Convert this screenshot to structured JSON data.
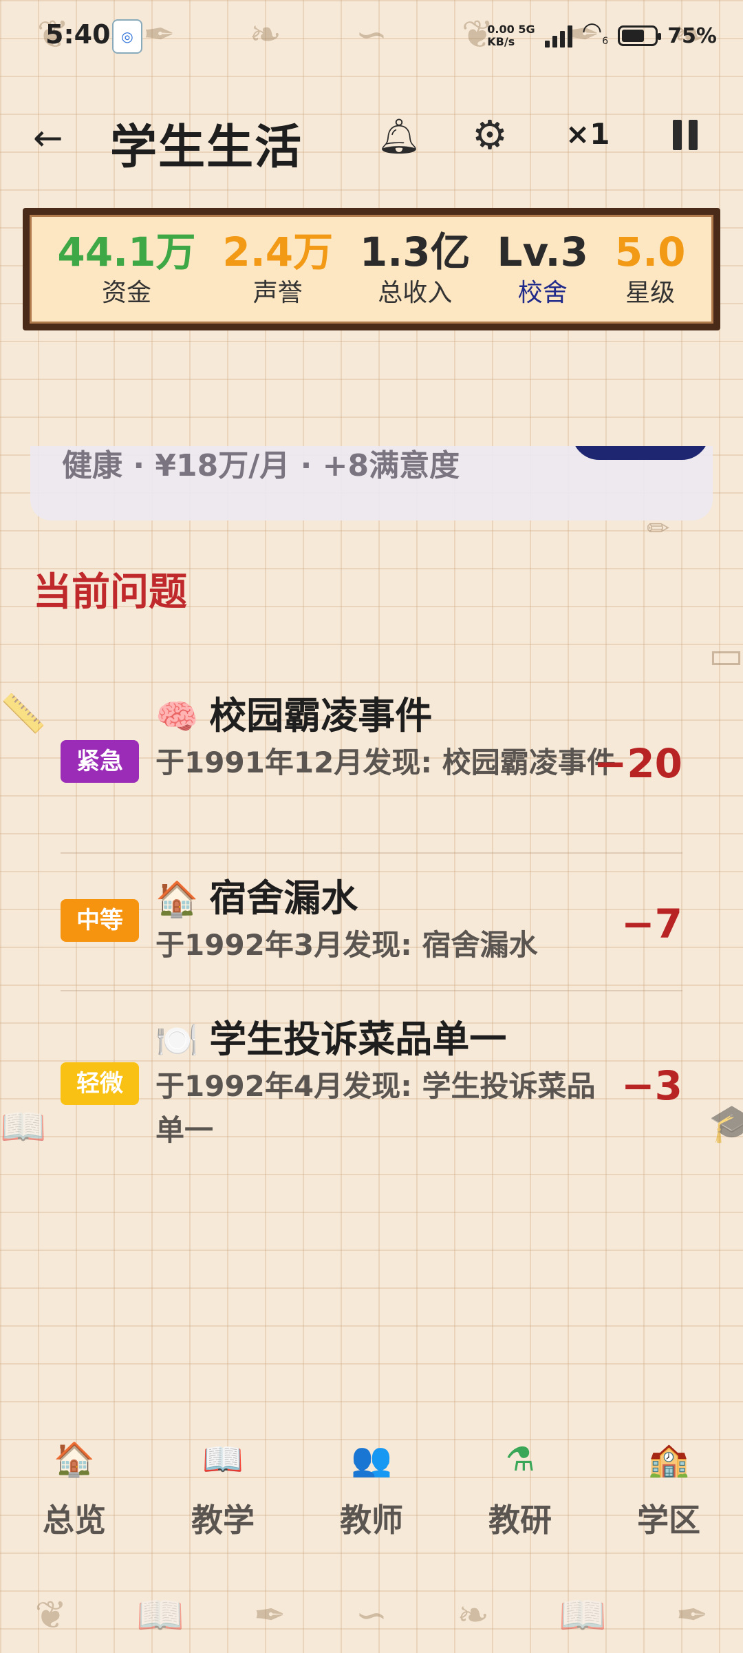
{
  "status_bar": {
    "time": "5:40",
    "network_speed_top": "0.00",
    "network_type": "5G",
    "network_speed_unit": "KB/s",
    "wifi_badge": "6",
    "battery": "75%"
  },
  "app_bar": {
    "title": "学生生活",
    "speed": "×1"
  },
  "stats": [
    {
      "value": "44.1万",
      "label": "资金",
      "value_color": "#3fa846",
      "label_color": "#333333"
    },
    {
      "value": "2.4万",
      "label": "声誉",
      "value_color": "#f29a16",
      "label_color": "#333333"
    },
    {
      "value": "1.3亿",
      "label": "总收入",
      "value_color": "#2b2b2b",
      "label_color": "#333333"
    },
    {
      "value": "Lv.3",
      "label": "校舍",
      "value_color": "#2b2b2b",
      "label_color": "#1f2a8a"
    },
    {
      "value": "5.0",
      "label": "星级",
      "value_color": "#f29a16",
      "label_color": "#333333"
    }
  ],
  "partial_card": {
    "text": "健康 · ¥18万/月 · +8满意度"
  },
  "section_title": "当前问题",
  "issues": [
    {
      "severity": "紧急",
      "severity_color": "#9b2cb8",
      "emoji": "🧠",
      "title": "校园霸凌事件",
      "desc": "于1991年12月发现: 校园霸凌事件",
      "penalty": "−20"
    },
    {
      "severity": "中等",
      "severity_color": "#f7940f",
      "emoji": "🏠",
      "title": "宿舍漏水",
      "desc": "于1992年3月发现: 宿舍漏水",
      "penalty": "−7"
    },
    {
      "severity": "轻微",
      "severity_color": "#f8c114",
      "emoji": "🍽️",
      "title": "学生投诉菜品单一",
      "desc": "于1992年4月发现: 学生投诉菜品单一",
      "penalty": "−3"
    }
  ],
  "nav": [
    {
      "icon": "🏠",
      "icon_name": "school-house-icon",
      "label": "总览"
    },
    {
      "icon": "📖",
      "icon_name": "open-book-icon",
      "label": "教学"
    },
    {
      "icon": "👥",
      "icon_name": "teachers-icon",
      "label": "教师"
    },
    {
      "icon": "⚗",
      "icon_name": "flask-icon",
      "label": "教研"
    },
    {
      "icon": "🏫",
      "icon_name": "campus-building-icon",
      "label": "学区"
    }
  ]
}
